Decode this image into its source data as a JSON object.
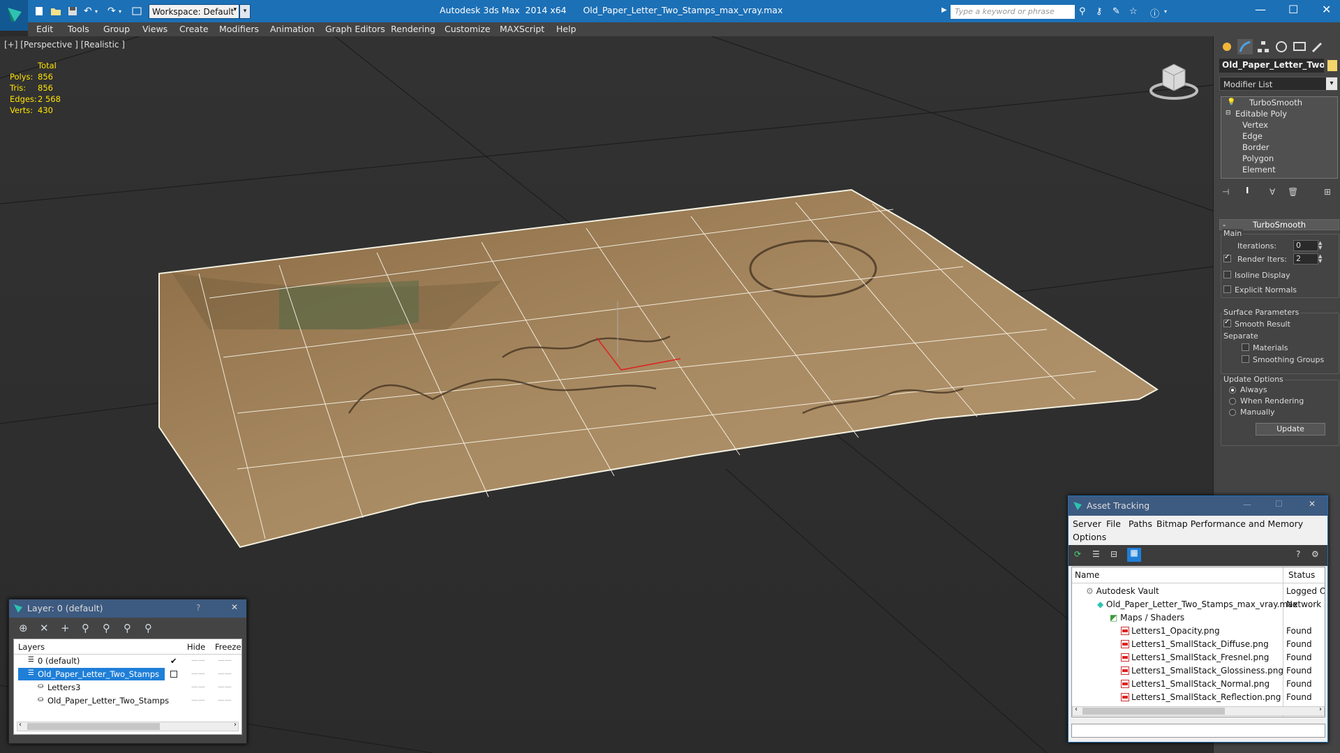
{
  "app": {
    "title": "Autodesk 3ds Max  2014 x64      Old_Paper_Letter_Two_Stamps_max_vray.max",
    "workspace": "Workspace: Default",
    "search_placeholder": "Type a keyword or phrase"
  },
  "menu": [
    "Edit",
    "Tools",
    "Group",
    "Views",
    "Create",
    "Modifiers",
    "Animation",
    "Graph Editors",
    "Rendering",
    "Customize",
    "MAXScript",
    "Help"
  ],
  "viewport": {
    "label": "[+] [Perspective ] [Realistic ]",
    "stats_header": "Total",
    "stats": [
      {
        "label": "Polys:",
        "value": "856"
      },
      {
        "label": "Tris:",
        "value": "856"
      },
      {
        "label": "Edges:",
        "value": "2 568"
      },
      {
        "label": "Verts:",
        "value": "430"
      }
    ]
  },
  "command_panel": {
    "object_name": "Old_Paper_Letter_Two_Stamps",
    "object_color": "#f3d46a",
    "modifier_list": "Modifier List",
    "stack": {
      "turbosmooth": "TurboSmooth",
      "editable_poly": "Editable Poly",
      "sub": [
        "Vertex",
        "Edge",
        "Border",
        "Polygon",
        "Element"
      ]
    },
    "rollout_title": "TurboSmooth",
    "main_label": "Main",
    "iterations_label": "Iterations:",
    "iterations_value": "0",
    "render_iters_label": "Render Iters:",
    "render_iters_value": "2",
    "isoline": "Isoline Display",
    "explicit_normals": "Explicit Normals",
    "surface_params": "Surface Parameters",
    "smooth_result": "Smooth Result",
    "separate": "Separate",
    "materials": "Materials",
    "smoothing_groups": "Smoothing Groups",
    "update_options": "Update Options",
    "always": "Always",
    "when_rendering": "When Rendering",
    "manually": "Manually",
    "update_button": "Update"
  },
  "layer_window": {
    "title": "Layer: 0 (default)",
    "help": "?",
    "col_layers": "Layers",
    "col_hide": "Hide",
    "col_freeze": "Freeze",
    "rows": [
      {
        "name": "0 (default)"
      },
      {
        "name": "Old_Paper_Letter_Two_Stamps"
      },
      {
        "name": "Letters3"
      },
      {
        "name": "Old_Paper_Letter_Two_Stamps"
      }
    ]
  },
  "asset_window": {
    "title": "Asset Tracking",
    "menu": [
      "Server",
      "File",
      "Paths",
      "Bitmap Performance and Memory",
      "Options"
    ],
    "col_name": "Name",
    "col_status": "Status",
    "rows": [
      {
        "name": "Autodesk Vault",
        "status": "Logged O"
      },
      {
        "name": "Old_Paper_Letter_Two_Stamps_max_vray.max",
        "status": "Network I"
      },
      {
        "name": "Maps / Shaders",
        "status": ""
      },
      {
        "name": "Letters1_Opacity.png",
        "status": "Found"
      },
      {
        "name": "Letters1_SmallStack_Diffuse.png",
        "status": "Found"
      },
      {
        "name": "Letters1_SmallStack_Fresnel.png",
        "status": "Found"
      },
      {
        "name": "Letters1_SmallStack_Glossiness.png",
        "status": "Found"
      },
      {
        "name": "Letters1_SmallStack_Normal.png",
        "status": "Found"
      },
      {
        "name": "Letters1_SmallStack_Reflection.png",
        "status": "Found"
      }
    ]
  }
}
